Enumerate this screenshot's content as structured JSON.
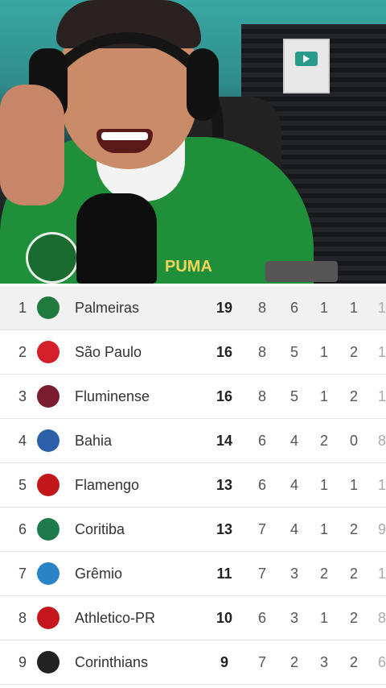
{
  "video": {
    "description_icon": "person-video",
    "plaque_icon": "play-button-icon",
    "shirt_brand": "PUMA"
  },
  "rows": [
    {
      "pos": "1",
      "team": "Palmeiras",
      "pts": "19",
      "p": "8",
      "w": "6",
      "d": "1",
      "l": "1",
      "extra": "1",
      "color": "#1e7a3c",
      "highlight": true
    },
    {
      "pos": "2",
      "team": "São Paulo",
      "pts": "16",
      "p": "8",
      "w": "5",
      "d": "1",
      "l": "2",
      "extra": "1",
      "color": "#d21f2a",
      "highlight": false
    },
    {
      "pos": "3",
      "team": "Fluminense",
      "pts": "16",
      "p": "8",
      "w": "5",
      "d": "1",
      "l": "2",
      "extra": "1",
      "color": "#7a1c2e",
      "highlight": false
    },
    {
      "pos": "4",
      "team": "Bahia",
      "pts": "14",
      "p": "6",
      "w": "4",
      "d": "2",
      "l": "0",
      "extra": "8",
      "color": "#2b5fa8",
      "highlight": false
    },
    {
      "pos": "5",
      "team": "Flamengo",
      "pts": "13",
      "p": "6",
      "w": "4",
      "d": "1",
      "l": "1",
      "extra": "1",
      "color": "#c2161b",
      "highlight": false
    },
    {
      "pos": "6",
      "team": "Coritiba",
      "pts": "13",
      "p": "7",
      "w": "4",
      "d": "1",
      "l": "2",
      "extra": "9",
      "color": "#1e7a4a",
      "highlight": false
    },
    {
      "pos": "7",
      "team": "Grêmio",
      "pts": "11",
      "p": "7",
      "w": "3",
      "d": "2",
      "l": "2",
      "extra": "1",
      "color": "#2a83c4",
      "highlight": false
    },
    {
      "pos": "8",
      "team": "Athletico-PR",
      "pts": "10",
      "p": "6",
      "w": "3",
      "d": "1",
      "l": "2",
      "extra": "8",
      "color": "#c4161c",
      "highlight": false
    },
    {
      "pos": "9",
      "team": "Corinthians",
      "pts": "9",
      "p": "7",
      "w": "2",
      "d": "3",
      "l": "2",
      "extra": "6",
      "color": "#222222",
      "highlight": false
    }
  ]
}
